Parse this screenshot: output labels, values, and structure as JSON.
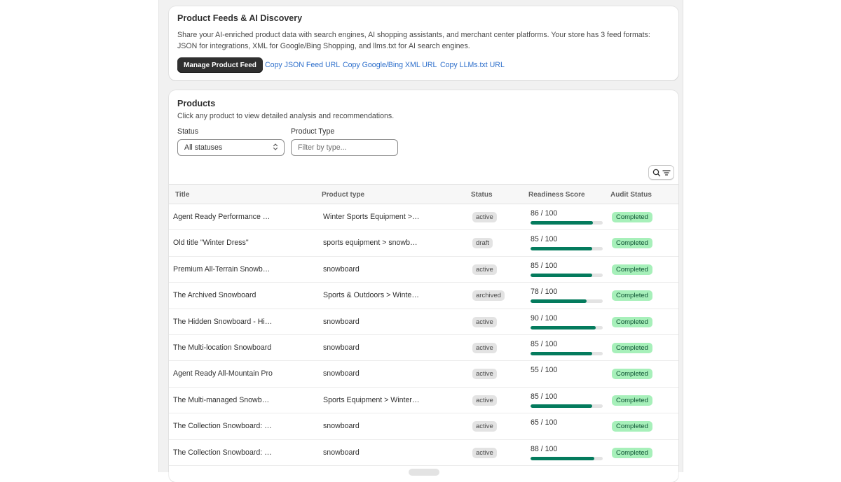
{
  "feeds": {
    "title": "Product Feeds & AI Discovery",
    "description": "Share your AI-enriched product data with search engines, AI shopping assistants, and merchant center platforms. Your store has 3 feed formats: JSON for integrations, XML for Google/Bing Shopping, and llms.txt for AI search engines.",
    "manage_label": "Manage Product Feed",
    "copy_json_label": "Copy JSON Feed URL",
    "copy_xml_label": "Copy Google/Bing XML URL",
    "copy_llms_label": "Copy LLMs.txt URL"
  },
  "products": {
    "title": "Products",
    "subtitle": "Click any product to view detailed analysis and recommendations.",
    "status_filter_label": "Status",
    "status_filter_value": "All statuses",
    "type_filter_label": "Product Type",
    "type_filter_placeholder": "Filter by type...",
    "columns": {
      "title": "Title",
      "type": "Product type",
      "status": "Status",
      "score": "Readiness Score",
      "audit": "Audit Status"
    },
    "rows": [
      {
        "title": "Agent Ready Performance Snowboard",
        "type": "Winter Sports Equipment > Snowboards",
        "status": "active",
        "score_text": "86 / 100",
        "score": 86,
        "audit": "Completed"
      },
      {
        "title": "Old title \"Winter Dress\"",
        "type": "sports equipment > snowboards",
        "status": "draft",
        "score_text": "85 / 100",
        "score": 85,
        "audit": "Completed"
      },
      {
        "title": "Premium All-Terrain Snowboard",
        "type": "snowboard",
        "status": "active",
        "score_text": "85 / 100",
        "score": 85,
        "audit": "Completed"
      },
      {
        "title": "The Archived Snowboard",
        "type": "Sports & Outdoors > Winter Sports",
        "status": "archived",
        "score_text": "78 / 100",
        "score": 78,
        "audit": "Completed"
      },
      {
        "title": "The Hidden Snowboard - Hidden Edition",
        "type": "snowboard",
        "status": "active",
        "score_text": "90 / 100",
        "score": 90,
        "audit": "Completed"
      },
      {
        "title": "The Multi-location Snowboard",
        "type": "snowboard",
        "status": "active",
        "score_text": "85 / 100",
        "score": 85,
        "audit": "Completed"
      },
      {
        "title": "Agent Ready All-Mountain Pro",
        "type": "snowboard",
        "status": "active",
        "score_text": "55 / 100",
        "score": 0,
        "audit": "Completed"
      },
      {
        "title": "The Multi-managed Snowboard",
        "type": "Sports Equipment > Winter Sports",
        "status": "active",
        "score_text": "85 / 100",
        "score": 85,
        "audit": "Completed"
      },
      {
        "title": "The Collection Snowboard: Liquid",
        "type": "snowboard",
        "status": "active",
        "score_text": "65 / 100",
        "score": 0,
        "audit": "Completed"
      },
      {
        "title": "The Collection Snowboard: Hydrogen",
        "type": "snowboard",
        "status": "active",
        "score_text": "88 / 100",
        "score": 88,
        "audit": "Completed"
      }
    ]
  },
  "colors": {
    "accent": "#047b5d",
    "link": "#2c6ecb",
    "completed_bg": "#a7f0ba",
    "status_bg": "#e3e3e3"
  },
  "icons": {
    "search": "search-icon",
    "filter": "filter-lines-icon",
    "select": "chevron-up-down-icon"
  }
}
